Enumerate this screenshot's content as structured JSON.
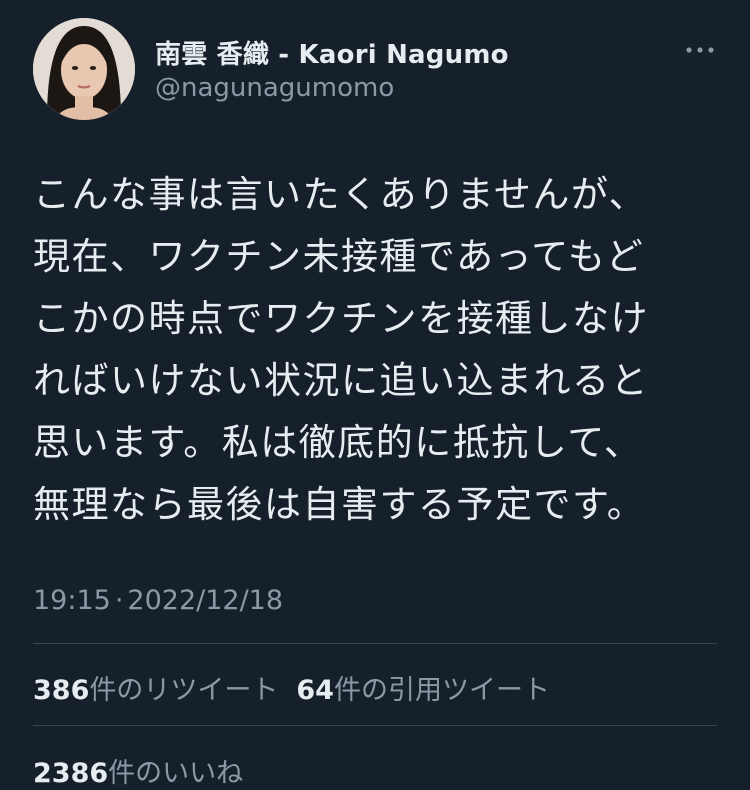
{
  "author": {
    "display_name": "南雲 香織 - Kaori Nagumo",
    "handle": "@nagunagumomo"
  },
  "tweet": {
    "text": "こんな事は言いたくありませんが、\n現在、ワクチン未接種であってもど\nこかの時点でワクチンを接種しなけ\nればいけない状況に追い込まれると\n思います。私は徹底的に抵抗して、\n無理なら最後は自害する予定です。",
    "time": "19:15",
    "separator": "·",
    "date": "2022/12/18"
  },
  "stats": {
    "retweets": {
      "count": "386",
      "label": "件のリツイート"
    },
    "quotes": {
      "count": "64",
      "label": "件の引用ツイート"
    },
    "likes": {
      "count": "2386",
      "label": "件のいいね"
    }
  },
  "icons": {
    "more": "more-horizontal-icon"
  },
  "colors": {
    "background": "#15202b",
    "primary_text": "#e7ecf0",
    "secondary_text": "#8b98a5",
    "divider": "#38444d"
  }
}
